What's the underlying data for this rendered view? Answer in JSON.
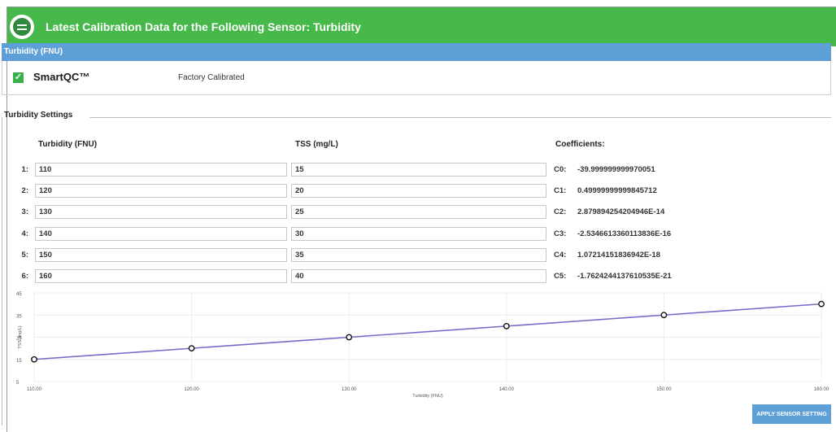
{
  "header": {
    "title": "Latest Calibration Data for the Following Sensor:  Turbidity",
    "icon": "sensor-icon"
  },
  "panel": {
    "title": "Turbidity (FNU)",
    "smartqc_label": "SmartQC™",
    "smartqc_checked": true,
    "status": "Factory Calibrated"
  },
  "settings": {
    "title": "Turbidity Settings",
    "col_turbidity": "Turbidity (FNU)",
    "col_tss": "TSS (mg/L)",
    "col_coefficients": "Coefficients:",
    "rows": [
      {
        "num": "1:",
        "turbidity": "110",
        "tss": "15",
        "coef_label": "C0:",
        "coef_value": "-39.999999999970051"
      },
      {
        "num": "2:",
        "turbidity": "120",
        "tss": "20",
        "coef_label": "C1:",
        "coef_value": "0.49999999999845712"
      },
      {
        "num": "3:",
        "turbidity": "130",
        "tss": "25",
        "coef_label": "C2:",
        "coef_value": "2.879894254204946E-14"
      },
      {
        "num": "4:",
        "turbidity": "140",
        "tss": "30",
        "coef_label": "C3:",
        "coef_value": "-2.5346613360113836E-16"
      },
      {
        "num": "5:",
        "turbidity": "150",
        "tss": "35",
        "coef_label": "C4:",
        "coef_value": "1.07214151836942E-18"
      },
      {
        "num": "6:",
        "turbidity": "160",
        "tss": "40",
        "coef_label": "C5:",
        "coef_value": "-1.7624244137610535E-21"
      }
    ]
  },
  "chart_data": {
    "type": "line",
    "x": [
      110,
      120,
      130,
      140,
      150,
      160
    ],
    "series": [
      {
        "values": [
          15,
          20,
          25,
          30,
          35,
          40
        ],
        "color": "#7b68c8"
      }
    ],
    "xlabel": "Turbidity (FNU)",
    "ylabel": "TSS (mg/L)",
    "xlim": [
      110,
      160
    ],
    "ylim": [
      5,
      45
    ],
    "x_ticks": [
      "110.00",
      "120.00",
      "130.00",
      "140.00",
      "150.00",
      "160.00"
    ],
    "y_ticks": [
      "5",
      "15",
      "25",
      "35",
      "45"
    ],
    "grid": true
  },
  "actions": {
    "apply_label": "APPLY SENSOR SETTING"
  },
  "colors": {
    "header": "#46b94a",
    "accent_blue": "#5e9fd8",
    "line": "#7b68c8"
  }
}
